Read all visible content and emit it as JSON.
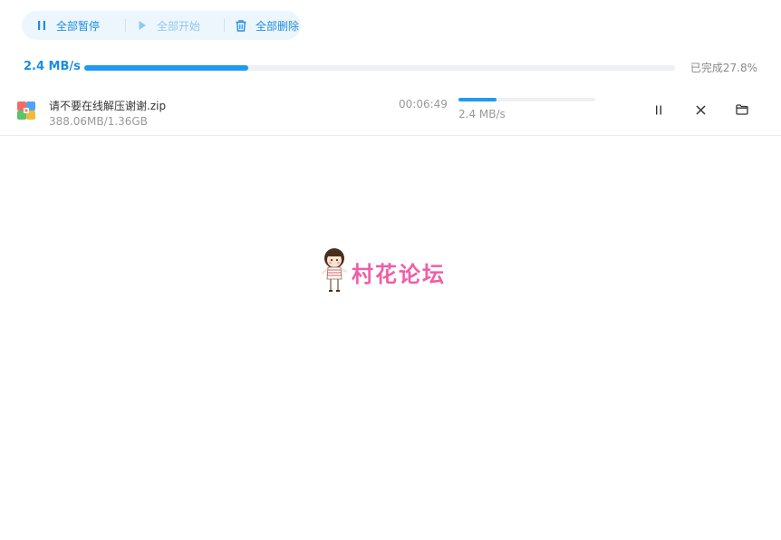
{
  "toolbar": {
    "pause_all": "全部暂停",
    "start_all": "全部开始",
    "delete_all": "全部删除"
  },
  "summary": {
    "speed": "2.4 MB/s",
    "progress_percent": 27.8,
    "progress_label": "已完成27.8%"
  },
  "task": {
    "file_name": "请不要在线解压谢谢.zip",
    "file_size": "388.06MB/1.36GB",
    "time_remaining": "00:06:49",
    "progress_percent": 27.8,
    "speed": "2.4 MB/s"
  },
  "watermark": {
    "text": "村花论坛"
  },
  "colors": {
    "accent": "#1e9bf0",
    "accent_light": "#eef6fd",
    "watermark": "#ee5fa7"
  }
}
